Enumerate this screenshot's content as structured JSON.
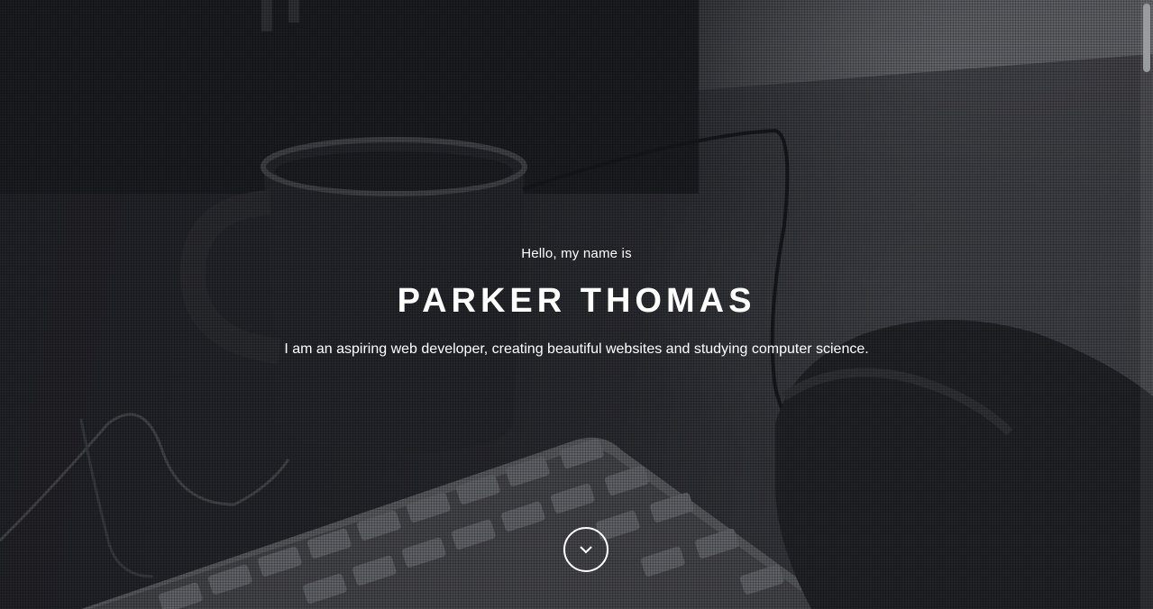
{
  "hero": {
    "greeting": "Hello, my name is",
    "name": "PARKER THOMAS",
    "tagline": "I am an aspiring web developer, creating beautiful websites and studying computer science."
  },
  "scroll_button": {
    "icon": "chevron-down-icon"
  },
  "colors": {
    "text": "#ffffff",
    "overlay": "#1c1e22"
  }
}
